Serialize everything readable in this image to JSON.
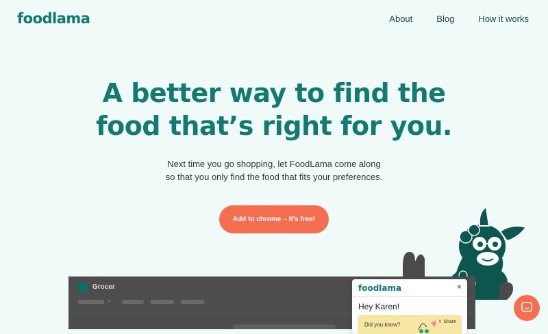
{
  "header": {
    "logo": "foodlama",
    "nav": [
      "About",
      "Blog",
      "How it works"
    ]
  },
  "hero": {
    "headline_line1": "A better way to find the",
    "headline_line2": "food that’s right for you.",
    "sub_line1": "Next time you go shopping, let FoodLama come along",
    "sub_line2": "so that you only find the food that fits your preferences.",
    "cta": "Add to chrome – It’s free!"
  },
  "browser_mock": {
    "title": "Grocer",
    "chevron": "⌄"
  },
  "popup": {
    "logo": "foodlama",
    "close": "×",
    "greeting": "Hey Karen!",
    "card_text": "Did you know?",
    "share": "Share"
  },
  "colors": {
    "background": "#effaf9",
    "brand": "#127a70",
    "accent": "#f56e4f",
    "llama": "#0e5650"
  },
  "icons": {
    "chat": "chat-bubble-icon",
    "close": "close-icon",
    "share": "share-icon"
  }
}
